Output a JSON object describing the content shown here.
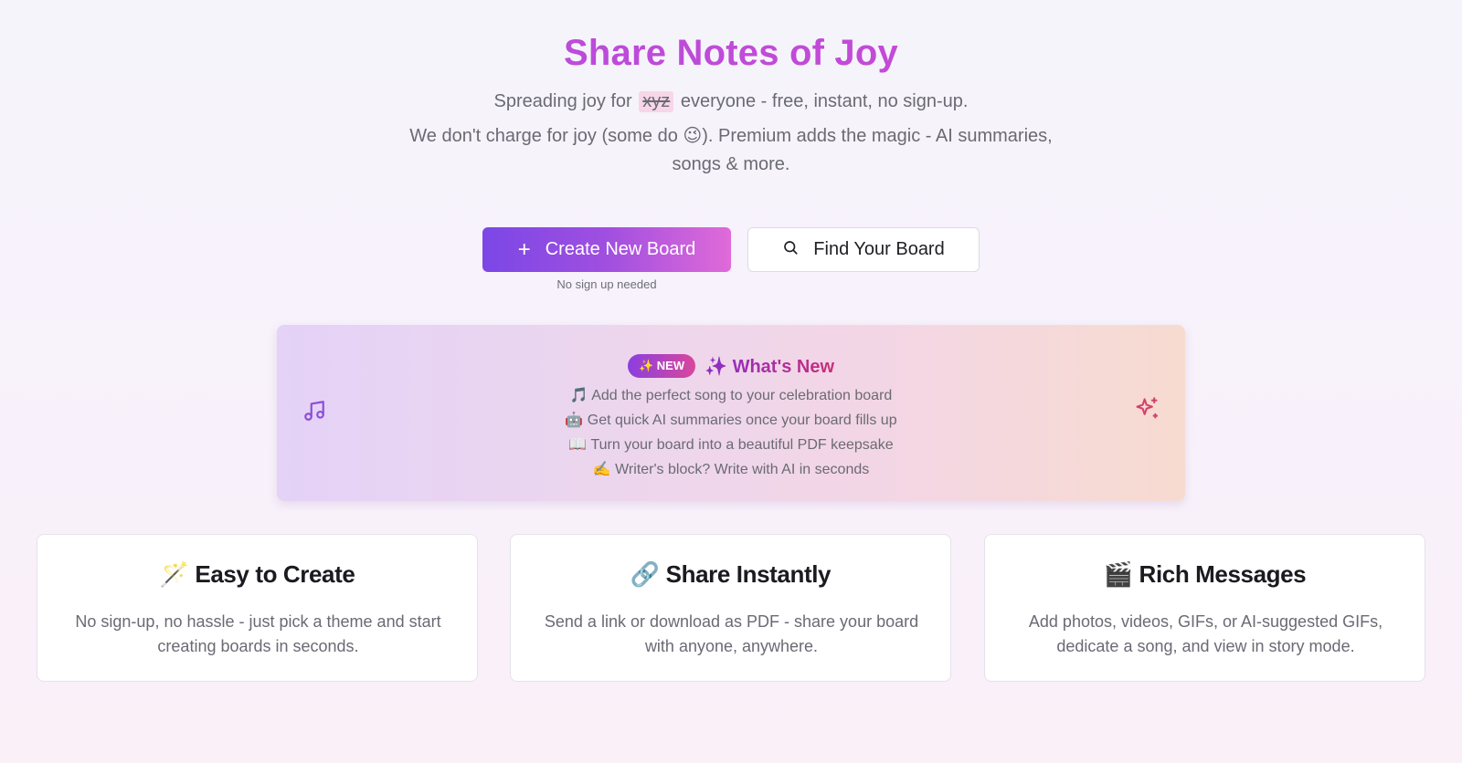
{
  "hero": {
    "title": "Share Notes of Joy",
    "subtitle_prefix": "Spreading joy for",
    "subtitle_struck": "xyz",
    "subtitle_suffix": "everyone - free, instant, no sign-up.",
    "tagline": "We don't charge for joy (some do 😉). Premium adds the magic - AI summaries, songs & more."
  },
  "actions": {
    "create_label": "Create New Board",
    "create_note": "No sign up needed",
    "find_label": "Find Your Board"
  },
  "whats_new": {
    "badge": "✨ NEW",
    "title": "✨ What's New",
    "items": [
      "🎵 Add the perfect song to your celebration board",
      "🤖 Get quick AI summaries once your board fills up",
      "📖 Turn your board into a beautiful PDF keepsake",
      "✍️ Writer's block? Write with AI in seconds"
    ],
    "icon_left": "music-icon",
    "icon_right": "sparkles-icon"
  },
  "features": [
    {
      "title": "🪄 Easy to Create",
      "text": "No sign-up, no hassle - just pick a theme and start creating boards in seconds."
    },
    {
      "title": "🔗 Share Instantly",
      "text": "Send a link or download as PDF - share your board with anyone, anywhere."
    },
    {
      "title": "🎬 Rich Messages",
      "text": "Add photos, videos, GIFs, or AI-suggested GIFs, dedicate a song, and view in story mode."
    }
  ],
  "colors": {
    "accent_start": "#7b47e6",
    "accent_end": "#e06ad8",
    "title": "#b04be0",
    "muted_text": "#6a6a74"
  }
}
